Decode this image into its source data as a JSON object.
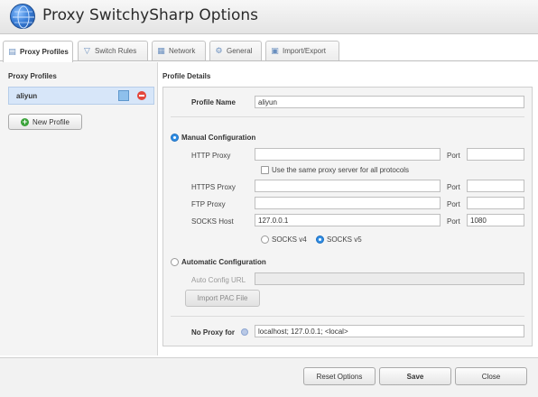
{
  "app": {
    "title": "Proxy SwitchySharp Options",
    "logo_icon": "globe-icon"
  },
  "tabs": [
    {
      "label": "Proxy Profiles",
      "icon": "profiles-icon",
      "active": true
    },
    {
      "label": "Switch Rules",
      "icon": "filter-icon",
      "active": false
    },
    {
      "label": "Network",
      "icon": "network-icon",
      "active": false
    },
    {
      "label": "General",
      "icon": "gear-icon",
      "active": false
    },
    {
      "label": "Import/Export",
      "icon": "save-icon",
      "active": false
    }
  ],
  "profiles": {
    "heading": "Proxy Profiles",
    "items": [
      {
        "name": "aliyun",
        "color": "#8ec0ec"
      }
    ],
    "new_profile_label": "New Profile"
  },
  "details": {
    "heading": "Profile Details",
    "profile_name_label": "Profile Name",
    "profile_name_value": "aliyun",
    "manual_label": "Manual Configuration",
    "manual_selected": true,
    "http_proxy_label": "HTTP Proxy",
    "http_proxy_value": "",
    "http_port_label": "Port",
    "http_port_value": "",
    "same_proxy_label": "Use the same proxy server for all protocols",
    "same_proxy_checked": false,
    "https_proxy_label": "HTTPS Proxy",
    "https_proxy_value": "",
    "https_port_label": "Port",
    "https_port_value": "",
    "ftp_proxy_label": "FTP Proxy",
    "ftp_proxy_value": "",
    "ftp_port_label": "Port",
    "ftp_port_value": "",
    "socks_host_label": "SOCKS Host",
    "socks_host_value": "127.0.0.1",
    "socks_port_label": "Port",
    "socks_port_value": "1080",
    "socks_v4_label": "SOCKS v4",
    "socks_v5_label": "SOCKS v5",
    "socks_version_selected": "v5",
    "auto_label": "Automatic Configuration",
    "auto_selected": false,
    "auto_url_label": "Auto Config URL",
    "auto_url_value": "",
    "import_pac_label": "Import PAC File",
    "no_proxy_label": "No Proxy for",
    "no_proxy_value": "localhost; 127.0.0.1; <local>"
  },
  "footer": {
    "reset_label": "Reset Options",
    "save_label": "Save",
    "close_label": "Close"
  },
  "colors": {
    "accent": "#2f8de4",
    "selected_row": "#d7e6f9",
    "delete": "#e4473d",
    "add": "#3aa33a"
  }
}
